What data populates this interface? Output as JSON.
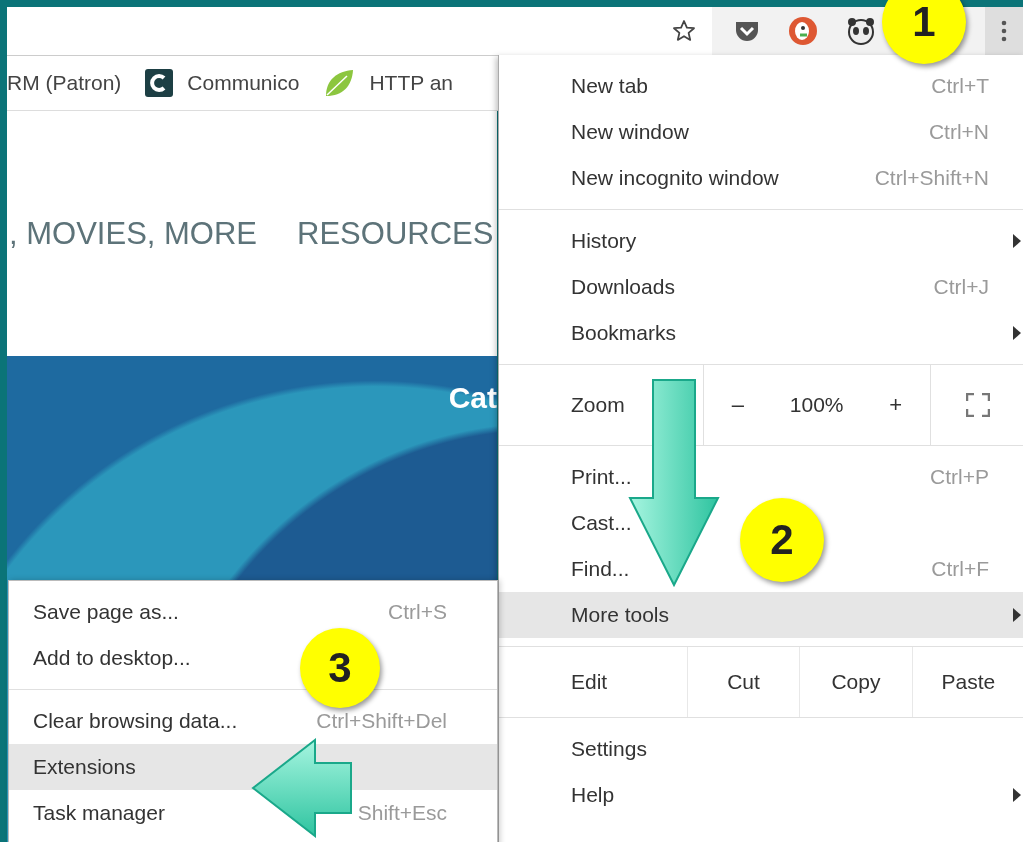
{
  "bookmarks": [
    {
      "label": "RM (Patron)",
      "kind": "plain"
    },
    {
      "label": "Communico",
      "kind": "logo"
    },
    {
      "label": "HTTP an",
      "kind": "leaf"
    }
  ],
  "nav": [
    ", MOVIES, MORE",
    "RESOURCES"
  ],
  "banner": {
    "text": "Cat"
  },
  "menu": {
    "sections": [
      [
        {
          "kind": "item",
          "label": "New tab",
          "shortcut": "Ctrl+T",
          "submenu": false,
          "selected": false
        },
        {
          "kind": "item",
          "label": "New window",
          "shortcut": "Ctrl+N",
          "submenu": false,
          "selected": false
        },
        {
          "kind": "item",
          "label": "New incognito window",
          "shortcut": "Ctrl+Shift+N",
          "submenu": false,
          "selected": false
        }
      ],
      [
        {
          "kind": "item",
          "label": "History",
          "submenu": true,
          "selected": false
        },
        {
          "kind": "item",
          "label": "Downloads",
          "shortcut": "Ctrl+J",
          "submenu": false,
          "selected": false
        },
        {
          "kind": "item",
          "label": "Bookmarks",
          "submenu": true,
          "selected": false
        }
      ],
      [
        {
          "kind": "zoom",
          "label": "Zoom",
          "minus": "–",
          "value": "100%",
          "plus": "+"
        }
      ],
      [
        {
          "kind": "item",
          "label": "Print...",
          "shortcut": "Ctrl+P",
          "submenu": false,
          "selected": false
        },
        {
          "kind": "item",
          "label": "Cast...",
          "submenu": false,
          "selected": false
        },
        {
          "kind": "item",
          "label": "Find...",
          "shortcut": "Ctrl+F",
          "submenu": false,
          "selected": false
        },
        {
          "kind": "item",
          "label": "More tools",
          "submenu": true,
          "selected": true
        }
      ],
      [
        {
          "kind": "edit",
          "label": "Edit",
          "buttons": [
            "Cut",
            "Copy",
            "Paste"
          ]
        }
      ],
      [
        {
          "kind": "item",
          "label": "Settings",
          "submenu": false,
          "selected": false
        },
        {
          "kind": "item",
          "label": "Help",
          "submenu": true,
          "selected": false
        }
      ]
    ]
  },
  "submenu": {
    "sections": [
      [
        {
          "kind": "item",
          "label": "Save page as...",
          "shortcut": "Ctrl+S",
          "submenu": false,
          "selected": false
        },
        {
          "kind": "item",
          "label": "Add to desktop...",
          "submenu": false,
          "selected": false
        }
      ],
      [
        {
          "kind": "item",
          "label": "Clear browsing data...",
          "shortcut": "Ctrl+Shift+Del",
          "submenu": false,
          "selected": false
        },
        {
          "kind": "item",
          "label": "Extensions",
          "submenu": false,
          "selected": true
        },
        {
          "kind": "item",
          "label": "Task manager",
          "shortcut": "Shift+Esc",
          "submenu": false,
          "selected": false
        }
      ]
    ]
  },
  "callouts": [
    "1",
    "2",
    "3"
  ]
}
